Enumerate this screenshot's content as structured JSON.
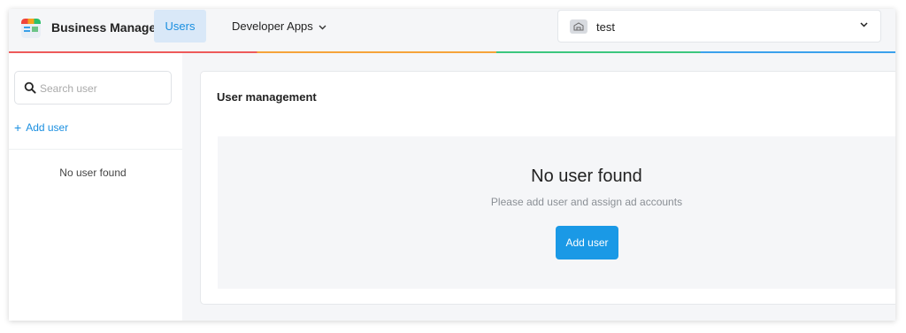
{
  "header": {
    "brand": "Business Manager",
    "nav": {
      "users_label": "Users",
      "developer_apps_label": "Developer Apps"
    },
    "account_selector": {
      "value": "test"
    }
  },
  "sidebar": {
    "search_placeholder": "Search user",
    "search_value": "",
    "add_user_label": "Add user",
    "empty_text": "No user found"
  },
  "main": {
    "card_title": "User management",
    "empty_state": {
      "title": "No user found",
      "subtitle": "Please add user and assign ad accounts",
      "button_label": "Add user"
    }
  },
  "colors": {
    "accent": "#1a99e6",
    "active_nav_bg": "#d9e8f8",
    "rainbow": [
      "#ee5a5a",
      "#f5a33a",
      "#3cc77e",
      "#3ba1ec"
    ]
  },
  "icons": [
    "app-logo-icon",
    "chevron-down-icon",
    "account-icon",
    "search-icon",
    "plus-icon"
  ]
}
